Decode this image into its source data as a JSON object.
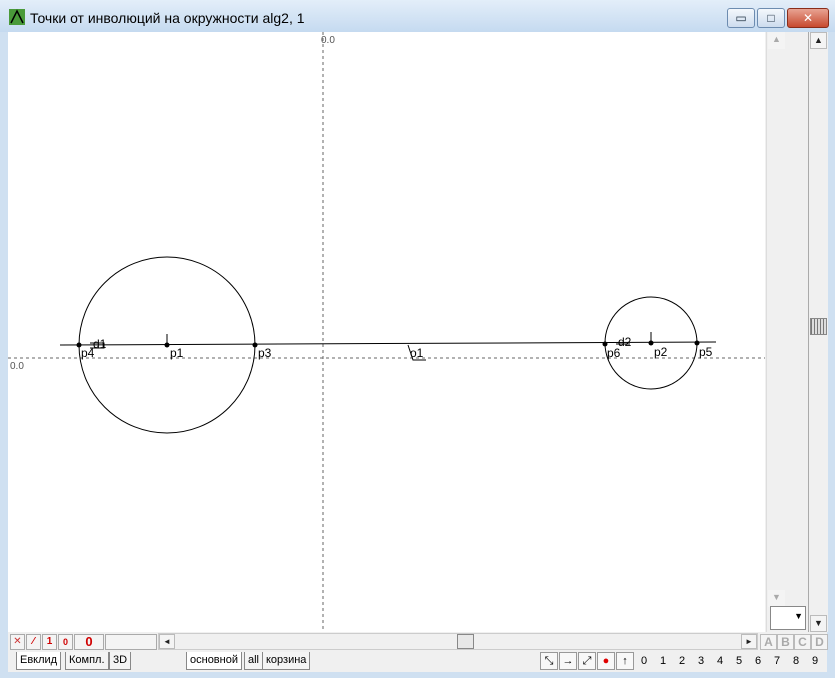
{
  "window": {
    "title": "Точки от инволюций на окружности alg2, 1",
    "controls": {
      "minimize": "▭",
      "maximize": "□",
      "close": "✕"
    }
  },
  "canvas": {
    "axis_top_label": "0.0",
    "axis_left_label": "0.0",
    "labels": {
      "d1": "d1",
      "d2": "d2",
      "p1": "p1",
      "p2": "p2",
      "p3": "p3",
      "p4": "p4",
      "p5": "p5",
      "p6": "p6",
      "o1": "o1"
    }
  },
  "scrollbar": {
    "up": "▲",
    "down": "▼",
    "left": "◄",
    "right": "►"
  },
  "toolbar_left": {
    "cross": "✕",
    "slash": "⁄",
    "one": "1",
    "zero_small": "0",
    "zero_big": "0"
  },
  "layers_letters": [
    "A",
    "B",
    "C",
    "D"
  ],
  "tabs_left": [
    "Евклид",
    "Компл.",
    "3D"
  ],
  "tabs_right": [
    "основной",
    "all",
    "корзина"
  ],
  "tools": [
    "⤡",
    "→",
    "⤢",
    "●",
    "↑"
  ],
  "digits": [
    "0",
    "1",
    "2",
    "3",
    "4",
    "5",
    "6",
    "7",
    "8",
    "9"
  ]
}
